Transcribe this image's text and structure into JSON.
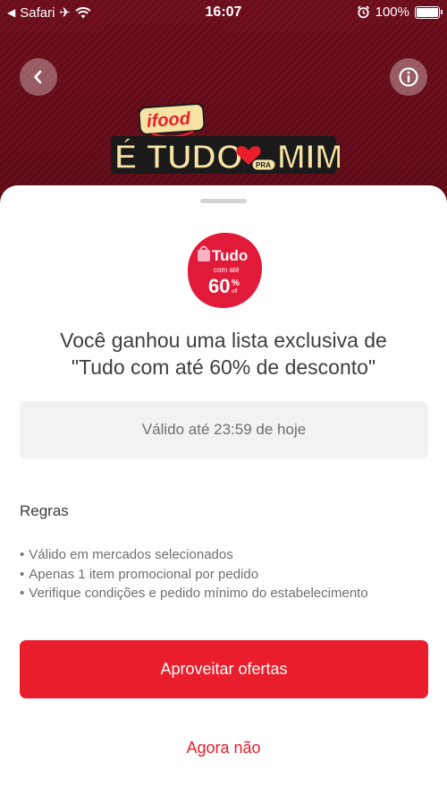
{
  "status_bar": {
    "carrier": "Safari",
    "time": "16:07",
    "battery": "100%"
  },
  "header": {
    "back_icon": "chevron-left-icon",
    "info_icon": "info-icon",
    "logo_lettering": "ifood É TUDO PRA MIM"
  },
  "badge": {
    "lettering": "Tudo com até 60% off"
  },
  "sheet": {
    "title_line1": "Você ganhou uma lista exclusiva de",
    "title_line2": "\"Tudo com até 60% de desconto\"",
    "validity": "Válido até 23:59 de hoje",
    "rules_title": "Regras",
    "rules": [
      "Válido em mercados selecionados",
      "Apenas 1 item promocional por pedido",
      "Verifique condições e pedido mínimo do estabelecimento"
    ],
    "primary_button": "Aproveitar ofertas",
    "secondary_link": "Agora não"
  },
  "colors": {
    "brand_red": "#ea1d2c",
    "header_bg": "#6b0c1a"
  }
}
